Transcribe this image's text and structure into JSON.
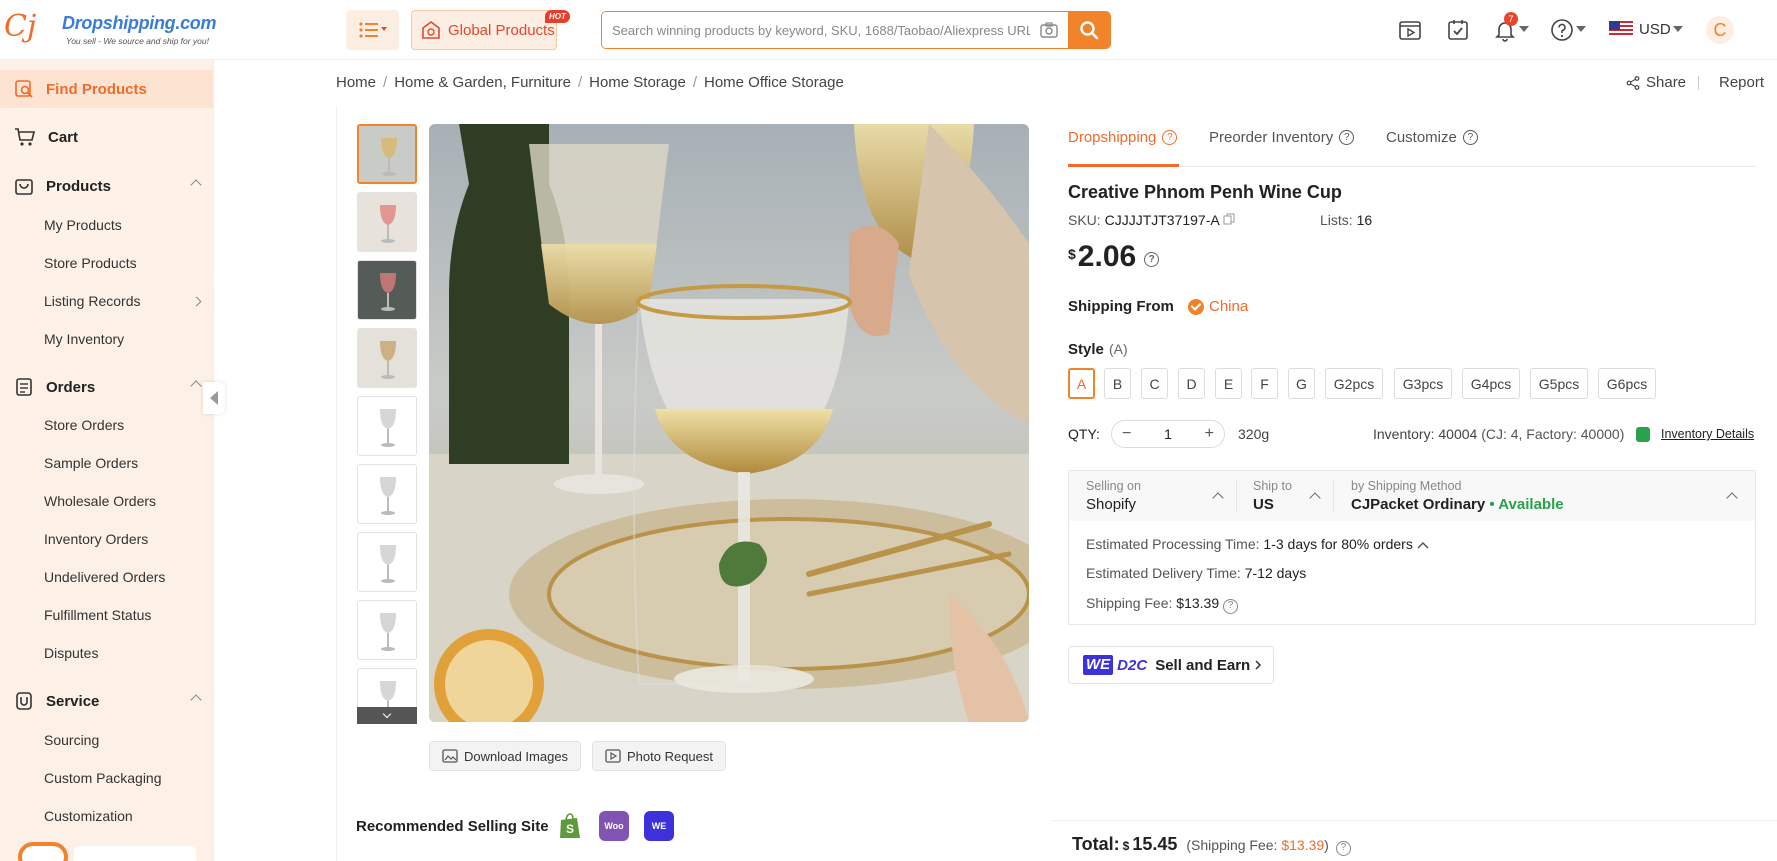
{
  "header": {
    "logo_name": "Dropshipping.com",
    "logo_tagline": "You sell - We source and ship for you!",
    "global_products_label": "Global Products",
    "hot_badge": "HOT",
    "search_placeholder": "Search winning products by keyword, SKU, 1688/Taobao/Aliexpress URL",
    "notification_count": "7",
    "currency": "USD",
    "avatar_initial": "C"
  },
  "sidebar": {
    "find_products": "Find Products",
    "cart": "Cart",
    "products": {
      "label": "Products",
      "items": [
        "My Products",
        "Store Products",
        "Listing Records",
        "My Inventory"
      ]
    },
    "orders": {
      "label": "Orders",
      "items": [
        "Store Orders",
        "Sample Orders",
        "Wholesale Orders",
        "Inventory Orders",
        "Undelivered Orders",
        "Fulfillment Status",
        "Disputes"
      ]
    },
    "service": {
      "label": "Service",
      "items": [
        "Sourcing",
        "Custom Packaging",
        "Customization"
      ]
    }
  },
  "breadcrumb": [
    "Home",
    "Home & Garden, Furniture",
    "Home Storage",
    "Home Office Storage"
  ],
  "page_actions": {
    "share": "Share",
    "report": "Report"
  },
  "gallery": {
    "download_images": "Download Images",
    "photo_request": "Photo Request",
    "thumbnail_count": 9
  },
  "recommended": {
    "label": "Recommended Selling Site",
    "sites": [
      "Shopify",
      "WooCommerce",
      "WE D2C"
    ],
    "site_marks": [
      "S",
      "Woo",
      "WE"
    ]
  },
  "tabs": [
    {
      "label": "Dropshipping",
      "active": true
    },
    {
      "label": "Preorder Inventory",
      "active": false
    },
    {
      "label": "Customize",
      "active": false
    }
  ],
  "product": {
    "title": "Creative Phnom Penh Wine Cup",
    "sku_label": "SKU:",
    "sku": "CJJJJTJT37197-A",
    "lists_label": "Lists:",
    "lists": "16",
    "currency_symbol": "$",
    "price": "2.06",
    "shipping_from_label": "Shipping From",
    "shipping_from": "China",
    "style_label": "Style",
    "style_selected": "(A)",
    "style_options": [
      "A",
      "B",
      "C",
      "D",
      "E",
      "F",
      "G",
      "G2pcs",
      "G3pcs",
      "G4pcs",
      "G5pcs",
      "G6pcs"
    ],
    "qty_label": "QTY:",
    "qty": "1",
    "weight": "320g",
    "inventory_text": "Inventory: 40004",
    "inventory_breakdown": "(CJ: 4, Factory: 40000)",
    "inventory_details": "Inventory Details"
  },
  "shipping": {
    "selling_on_label": "Selling on",
    "selling_on": "Shopify",
    "ship_to_label": "Ship to",
    "ship_to": "US",
    "method_label": "by Shipping Method",
    "method": "CJPacket Ordinary",
    "availability": "• Available",
    "processing_label": "Estimated Processing Time:",
    "processing": "1-3 days for 80% orders",
    "delivery_label": "Estimated Delivery Time:",
    "delivery": "7-12 days",
    "fee_label": "Shipping Fee:",
    "fee": "$13.39"
  },
  "we_d2c": {
    "we": "WE",
    "d2c": "D2C",
    "label": "Sell and Earn"
  },
  "total": {
    "label": "Total:",
    "currency_symbol": "$",
    "value": "15.45",
    "fee_prefix": "(Shipping Fee:",
    "fee": "$13.39",
    "fee_suffix": ")"
  },
  "colors": {
    "brand_orange": "#f1832b",
    "available_green": "#2aa14b",
    "we_purple": "#3d31d9"
  }
}
